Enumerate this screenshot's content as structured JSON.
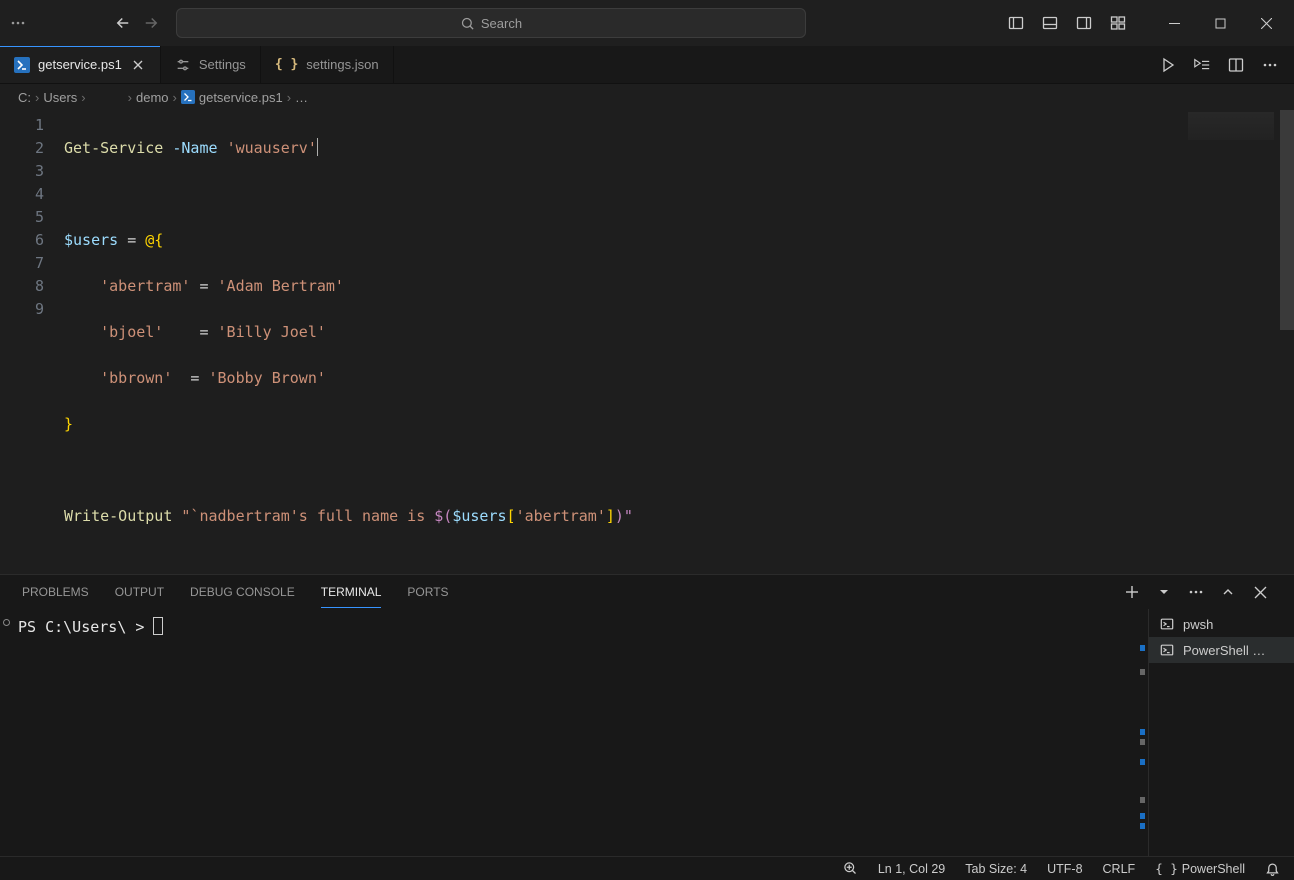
{
  "search": {
    "placeholder": "Search"
  },
  "tabs": [
    {
      "label": "getservice.ps1",
      "icon": "powershell-icon",
      "active": true,
      "dirty": false
    },
    {
      "label": "Settings",
      "icon": "settings-icon",
      "active": false
    },
    {
      "label": "settings.json",
      "icon": "json-icon",
      "active": false
    }
  ],
  "breadcrumb": {
    "segs": [
      "C:",
      "Users",
      "",
      "demo"
    ],
    "file": "getservice.ps1",
    "tail": "…"
  },
  "editor": {
    "line_numbers": [
      "1",
      "2",
      "3",
      "4",
      "5",
      "6",
      "7",
      "8",
      "9"
    ],
    "code": {
      "l1": {
        "cmd": "Get-Service",
        "param": "-Name",
        "str": "'wuauserv'"
      },
      "l3": {
        "var": "$users",
        "op": " = ",
        "punc1": "@{",
        "punc2": ""
      },
      "l4": {
        "key": "'abertram'",
        "op": " = ",
        "val": "'Adam Bertram'"
      },
      "l5": {
        "key": "'bjoel'",
        "op": "    = ",
        "val": "'Billy Joel'"
      },
      "l6": {
        "key": "'bbrown'",
        "op": "  = ",
        "val": "'Bobby Brown'"
      },
      "l7": {
        "punc": "}"
      },
      "l9": {
        "cmd": "Write-Output",
        "str_open": "\"`nadbertram's full name is ",
        "dollar": "$(",
        "var": "$users",
        "idx_open": "[",
        "idx": "'abertram'",
        "idx_close": "]",
        "close": ")\""
      }
    }
  },
  "panel": {
    "tabs": [
      "PROBLEMS",
      "OUTPUT",
      "DEBUG CONSOLE",
      "TERMINAL",
      "PORTS"
    ],
    "active_tab": "TERMINAL",
    "terminal_prompt": "PS C:\\Users\\       >",
    "terminals": [
      {
        "label": "pwsh",
        "active": false
      },
      {
        "label": "PowerShell …",
        "active": true
      }
    ]
  },
  "status": {
    "cursor": "Ln 1, Col 29",
    "tab": "Tab Size: 4",
    "enc": "UTF-8",
    "eol": "CRLF",
    "lang": "PowerShell"
  }
}
